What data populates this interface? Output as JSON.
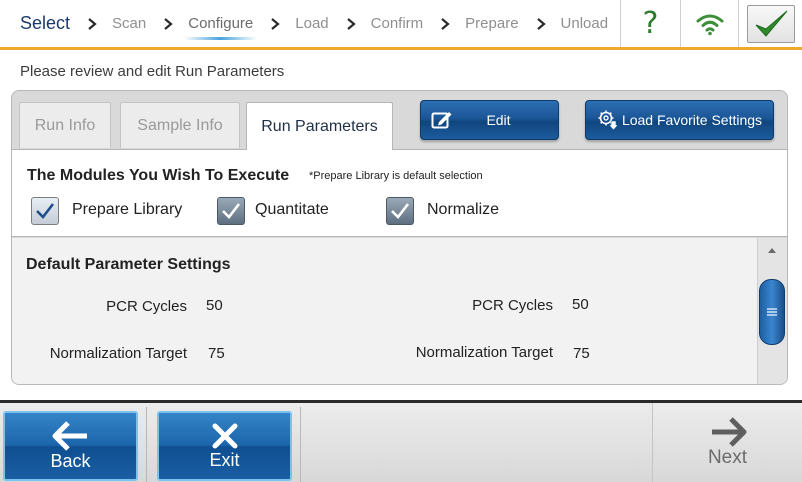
{
  "breadcrumb": {
    "steps": [
      "Select",
      "Scan",
      "Configure",
      "Load",
      "Confirm",
      "Prepare",
      "Unload"
    ],
    "active_step": "Configure"
  },
  "header": {
    "help_label": "?",
    "icons": [
      "help-icon",
      "wifi-icon",
      "checkmark-icon"
    ]
  },
  "subtitle": "Please review and edit Run Parameters",
  "tabs": [
    {
      "label": "Run Info",
      "selected": false
    },
    {
      "label": "Sample Info",
      "selected": false
    },
    {
      "label": "Run Parameters",
      "selected": true
    }
  ],
  "actions": {
    "edit_label": "Edit",
    "favorite_label": "Load Favorite Settings"
  },
  "modules": {
    "title": "The Modules You Wish To Execute",
    "note": "*Prepare Library is default selection",
    "options": [
      {
        "label": "Prepare Library",
        "checked": true
      },
      {
        "label": "Quantitate",
        "checked": true
      },
      {
        "label": "Normalize",
        "checked": true
      }
    ]
  },
  "parameters": {
    "title": "Default Parameter Settings",
    "columns": [
      {
        "rows": [
          {
            "label": "PCR Cycles",
            "value": "50"
          },
          {
            "label": "Normalization Target",
            "value": "75"
          }
        ]
      },
      {
        "rows": [
          {
            "label": "PCR Cycles",
            "value": "50"
          },
          {
            "label": "Normalization Target",
            "value": "75"
          }
        ]
      }
    ]
  },
  "footer": {
    "back_label": "Back",
    "exit_label": "Exit",
    "next_label": "Next"
  },
  "colors": {
    "accent_orange": "#f0a72a",
    "button_blue": "#1d66ac",
    "help_green": "#2f7b2c",
    "active_underline": "#49a3dd"
  }
}
